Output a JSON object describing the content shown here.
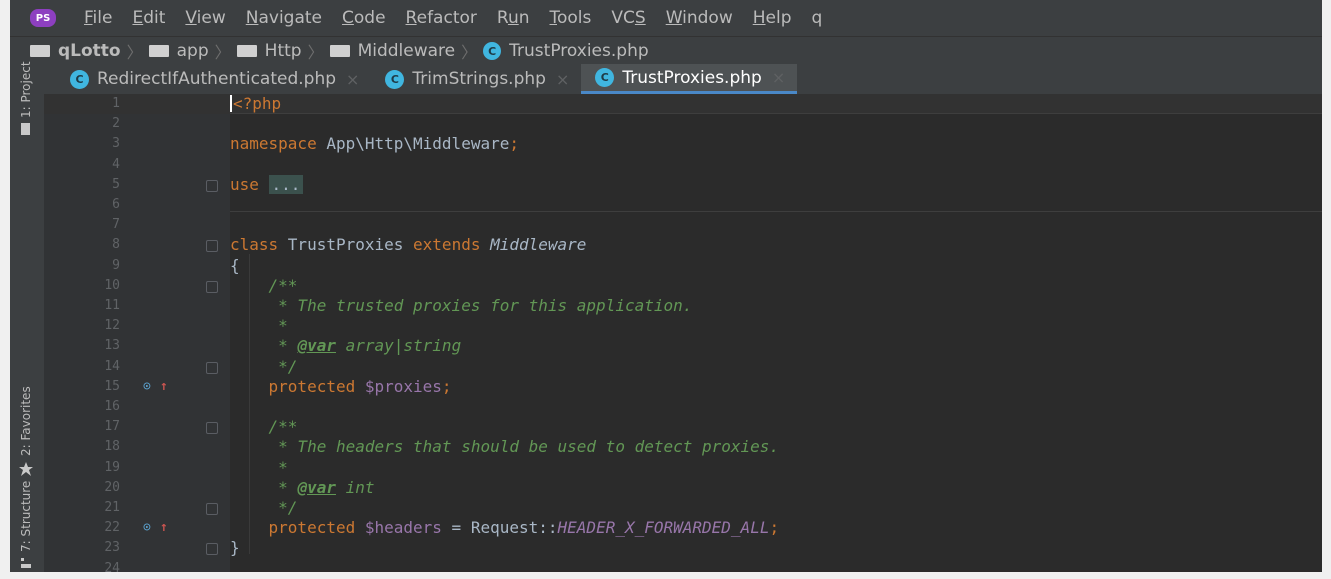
{
  "app": {
    "logo_text": "PS"
  },
  "menu": [
    {
      "pre": "",
      "mn": "F",
      "post": "ile"
    },
    {
      "pre": "",
      "mn": "E",
      "post": "dit"
    },
    {
      "pre": "",
      "mn": "V",
      "post": "iew"
    },
    {
      "pre": "",
      "mn": "N",
      "post": "avigate"
    },
    {
      "pre": "",
      "mn": "C",
      "post": "ode"
    },
    {
      "pre": "",
      "mn": "R",
      "post": "efactor"
    },
    {
      "pre": "R",
      "mn": "u",
      "post": "n"
    },
    {
      "pre": "",
      "mn": "T",
      "post": "ools"
    },
    {
      "pre": "VC",
      "mn": "S",
      "post": ""
    },
    {
      "pre": "",
      "mn": "W",
      "post": "indow"
    },
    {
      "pre": "",
      "mn": "H",
      "post": "elp"
    },
    {
      "pre": "q",
      "mn": "",
      "post": ""
    }
  ],
  "breadcrumb": {
    "project": "qLotto",
    "folders": [
      "app",
      "Http",
      "Middleware"
    ],
    "file": "TrustProxies.php"
  },
  "toolwindows": {
    "project": "1: Project",
    "favorites": "2: Favorites",
    "structure": "7: Structure"
  },
  "tabs": [
    {
      "label": "RedirectIfAuthenticated.php",
      "active": false
    },
    {
      "label": "TrimStrings.php",
      "active": false
    },
    {
      "label": "TrustProxies.php",
      "active": true
    }
  ],
  "tab_close_glyph": "×",
  "file_icon_letter": "C",
  "editor": {
    "lines": [
      {
        "n": "1",
        "tokens": [
          {
            "t": "<?php",
            "c": "kw"
          }
        ]
      },
      {
        "n": "2",
        "tokens": []
      },
      {
        "n": "3",
        "tokens": [
          {
            "t": "namespace ",
            "c": "kw"
          },
          {
            "t": "App\\Http\\Middleware",
            "c": ""
          },
          {
            "t": ";",
            "c": "kw"
          }
        ]
      },
      {
        "n": "4",
        "tokens": []
      },
      {
        "n": "5",
        "tokens": [
          {
            "t": "use ",
            "c": "kw"
          },
          {
            "t": "...",
            "c": "fold-pill"
          }
        ]
      },
      {
        "n": "6",
        "tokens": []
      },
      {
        "n": "7",
        "tokens": []
      },
      {
        "n": "8",
        "tokens": [
          {
            "t": "class ",
            "c": "kw"
          },
          {
            "t": "TrustProxies ",
            "c": ""
          },
          {
            "t": "extends ",
            "c": "kw"
          },
          {
            "t": "Middleware",
            "c": "cls-italic"
          }
        ]
      },
      {
        "n": "9",
        "tokens": [
          {
            "t": "{",
            "c": ""
          }
        ]
      },
      {
        "n": "10",
        "tokens": [
          {
            "t": "    /**",
            "c": "cmt"
          }
        ]
      },
      {
        "n": "11",
        "tokens": [
          {
            "t": "     * The trusted proxies for this application.",
            "c": "cmt"
          }
        ]
      },
      {
        "n": "12",
        "tokens": [
          {
            "t": "     *",
            "c": "cmt"
          }
        ]
      },
      {
        "n": "13",
        "tokens": [
          {
            "t": "     * ",
            "c": "cmt"
          },
          {
            "t": "@var",
            "c": "tag"
          },
          {
            "t": " array|string",
            "c": "cmt"
          }
        ]
      },
      {
        "n": "14",
        "tokens": [
          {
            "t": "     */",
            "c": "cmt"
          }
        ]
      },
      {
        "n": "15",
        "tokens": [
          {
            "t": "    protected ",
            "c": "kw"
          },
          {
            "t": "$proxies",
            "c": "var"
          },
          {
            "t": ";",
            "c": "kw"
          }
        ]
      },
      {
        "n": "16",
        "tokens": []
      },
      {
        "n": "17",
        "tokens": [
          {
            "t": "    /**",
            "c": "cmt"
          }
        ]
      },
      {
        "n": "18",
        "tokens": [
          {
            "t": "     * The headers that should be used to detect proxies.",
            "c": "cmt"
          }
        ]
      },
      {
        "n": "19",
        "tokens": [
          {
            "t": "     *",
            "c": "cmt"
          }
        ]
      },
      {
        "n": "20",
        "tokens": [
          {
            "t": "     * ",
            "c": "cmt"
          },
          {
            "t": "@var",
            "c": "tag"
          },
          {
            "t": " int",
            "c": "cmt"
          }
        ]
      },
      {
        "n": "21",
        "tokens": [
          {
            "t": "     */",
            "c": "cmt"
          }
        ]
      },
      {
        "n": "22",
        "tokens": [
          {
            "t": "    protected ",
            "c": "kw"
          },
          {
            "t": "$headers",
            "c": "var"
          },
          {
            "t": " = ",
            "c": ""
          },
          {
            "t": "Request",
            "c": ""
          },
          {
            "t": "::",
            "c": ""
          },
          {
            "t": "HEADER_X_FORWARDED_ALL",
            "c": "const"
          },
          {
            "t": ";",
            "c": "kw"
          }
        ]
      },
      {
        "n": "23",
        "tokens": [
          {
            "t": "}",
            "c": ""
          }
        ]
      },
      {
        "n": "24",
        "tokens": []
      }
    ],
    "override_lines": [
      "15",
      "22"
    ],
    "override_glyph": "⊙",
    "override_arrow": "↑"
  }
}
